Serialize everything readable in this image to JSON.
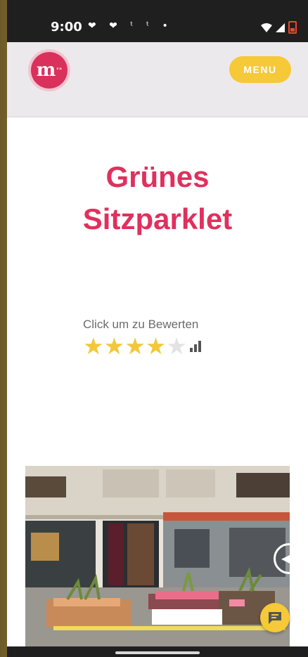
{
  "status_bar": {
    "time": "9:00",
    "icons_text": "♥ ♥ t t •"
  },
  "header": {
    "logo_text": "m",
    "logo_sup": "ʳᵃ",
    "menu_label": "MENU"
  },
  "title": {
    "line1": "Grünes",
    "line2": "Sitzparklet"
  },
  "rating": {
    "label": "Click um zu Bewerten",
    "value": 4,
    "max": 5
  },
  "colors": {
    "accent": "#e0305d",
    "button": "#f5c937",
    "star_filled": "#f2c83a",
    "star_empty": "#e3e3e3"
  }
}
